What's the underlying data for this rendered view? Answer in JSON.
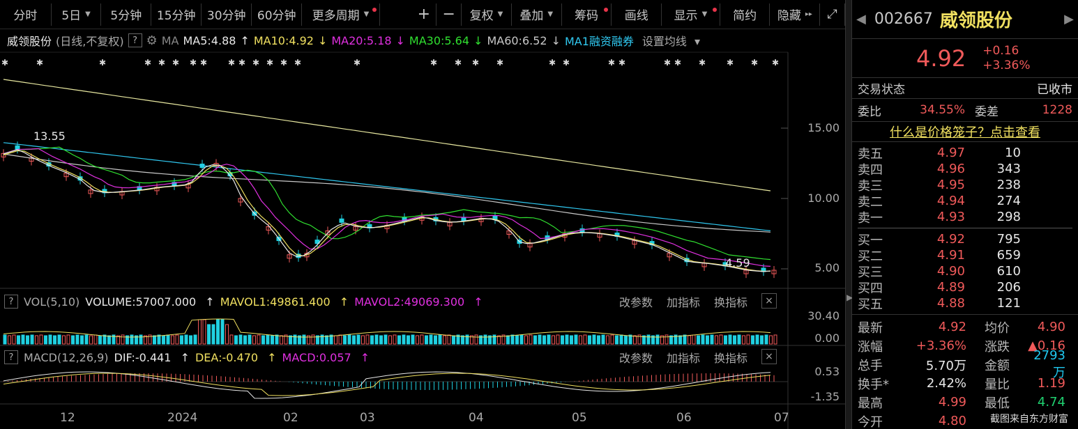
{
  "toolbar": {
    "items": [
      "分时",
      "5日",
      "5分钟",
      "15分钟",
      "30分钟",
      "60分钟",
      "更多周期",
      "复权",
      "叠加",
      "筹码",
      "画线",
      "显示",
      "简约",
      "隐藏"
    ],
    "plus": "+",
    "minus": "−",
    "expand_icon": "expand-icon",
    "accent": "#e8344a"
  },
  "ma_row": {
    "title": "威领股份",
    "subtitle": "(日线,不复权)",
    "question": "?",
    "ma_label": "MA",
    "ma5": "MA5:4.88",
    "ma10": "MA10:4.92",
    "ma20": "MA20:5.18",
    "ma30": "MA30:5.64",
    "ma60": "MA60:6.52",
    "ma1": "MA1融资融券",
    "settings": "设置均线",
    "colors": {
      "ma5": "#e8e8e8",
      "ma10": "#f0e060",
      "ma20": "#e030e0",
      "ma30": "#30e030",
      "ma60": "#c8c8c8",
      "ma1": "#30c8f0"
    }
  },
  "price_axis": [
    "15.00",
    "10.00",
    "5.00"
  ],
  "annotations": {
    "high": "13.55",
    "low": "4.59"
  },
  "vol": {
    "question": "?",
    "name": "VOL(5,10)",
    "volume": "VOLUME:57007.000",
    "mavol1": "MAVOL1:49861.400",
    "mavol2": "MAVOL2:49069.300",
    "btn1": "改参数",
    "btn2": "加指标",
    "btn3": "换指标",
    "close": "×",
    "axis": [
      "30.40",
      "0.00"
    ]
  },
  "macd": {
    "question": "?",
    "name": "MACD(12,26,9)",
    "dif": "DIF:-0.441",
    "dea": "DEA:-0.470",
    "macd": "MACD:0.057",
    "btn1": "改参数",
    "btn2": "加指标",
    "btn3": "换指标",
    "close": "×",
    "axis": [
      "0.53",
      "-1.35"
    ]
  },
  "x_axis": [
    "12",
    "2024",
    "02",
    "03",
    "04",
    "05",
    "06",
    "07"
  ],
  "stock": {
    "code": "002667",
    "name": "威领股份",
    "price": "4.92",
    "change": "+0.16",
    "change_pct": "+3.36%",
    "status_label": "交易状态",
    "status_value": "已收市",
    "weibi_label": "委比",
    "weibi_value": "34.55%",
    "weicha_label": "委差",
    "weicha_value": "1228",
    "link": "什么是价格笼子？点击查看"
  },
  "order_book": {
    "asks": [
      {
        "label": "卖五",
        "price": "4.97",
        "vol": "10"
      },
      {
        "label": "卖四",
        "price": "4.96",
        "vol": "343"
      },
      {
        "label": "卖三",
        "price": "4.95",
        "vol": "238"
      },
      {
        "label": "卖二",
        "price": "4.94",
        "vol": "274"
      },
      {
        "label": "卖一",
        "price": "4.93",
        "vol": "298"
      }
    ],
    "bids": [
      {
        "label": "买一",
        "price": "4.92",
        "vol": "795"
      },
      {
        "label": "买二",
        "price": "4.91",
        "vol": "659"
      },
      {
        "label": "买三",
        "price": "4.90",
        "vol": "610"
      },
      {
        "label": "买四",
        "price": "4.89",
        "vol": "206"
      },
      {
        "label": "买五",
        "price": "4.88",
        "vol": "121"
      }
    ]
  },
  "stats": [
    {
      "k": "最新",
      "v": "4.92",
      "vc": "red",
      "k2": "均价",
      "v2": "4.90",
      "v2c": "red"
    },
    {
      "k": "涨幅",
      "v": "+3.36%",
      "vc": "red",
      "k2": "涨跌",
      "v2": "▲0.16",
      "v2c": "red"
    },
    {
      "k": "总手",
      "v": "5.70万",
      "vc": "white",
      "k2": "金额",
      "v2": "2793万",
      "v2c": "blue"
    },
    {
      "k": "换手*",
      "v": "2.42%",
      "vc": "white",
      "k2": "量比",
      "v2": "1.19",
      "v2c": "red"
    },
    {
      "k": "最高",
      "v": "4.99",
      "vc": "red",
      "k2": "最低",
      "v2": "4.74",
      "v2c": "green"
    },
    {
      "k": "今开",
      "v": "4.80",
      "vc": "red",
      "k2": "",
      "v2": "",
      "v2c": "white"
    }
  ],
  "watermark": "截图来自东方财富"
}
